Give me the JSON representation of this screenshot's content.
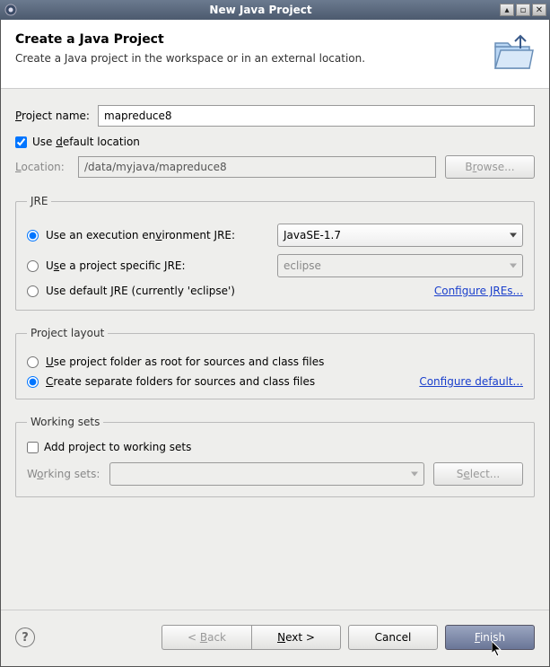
{
  "window": {
    "title": "New Java Project"
  },
  "header": {
    "title": "Create a Java Project",
    "subtitle": "Create a Java project in the workspace or in an external location."
  },
  "project": {
    "name_label": "Project name:",
    "name_value": "mapreduce8",
    "use_default_label": "Use default location",
    "use_default_checked": true,
    "location_label": "Location:",
    "location_value": "/data/myjava/mapreduce8",
    "browse_label": "Browse..."
  },
  "jre": {
    "legend": "JRE",
    "exec_env_label": "Use an execution environment JRE:",
    "exec_env_value": "JavaSE-1.7",
    "project_specific_label": "Use a project specific JRE:",
    "project_specific_value": "eclipse",
    "default_jre_label": "Use default JRE (currently 'eclipse')",
    "configure_link": "Configure JREs...",
    "selected": "exec_env"
  },
  "layout": {
    "legend": "Project layout",
    "root_label": "Use project folder as root for sources and class files",
    "separate_label": "Create separate folders for sources and class files",
    "configure_link": "Configure default...",
    "selected": "separate"
  },
  "working_sets": {
    "legend": "Working sets",
    "add_label": "Add project to working sets",
    "add_checked": false,
    "combo_label": "Working sets:",
    "combo_value": "",
    "select_label": "Select..."
  },
  "buttons": {
    "back": "< Back",
    "next": "Next >",
    "cancel": "Cancel",
    "finish": "Finish"
  }
}
